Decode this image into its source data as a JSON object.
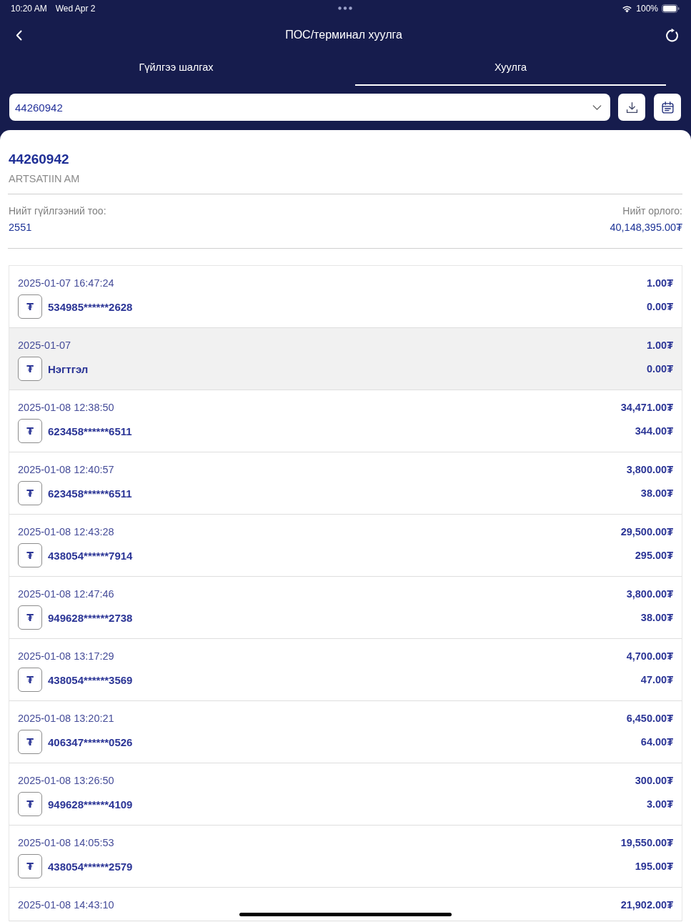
{
  "status_bar": {
    "time": "10:20 AM",
    "date": "Wed Apr 2",
    "battery": "100%"
  },
  "header": {
    "title": "ПОС/терминал хуулга"
  },
  "tabs": [
    {
      "label": "Гүйлгээ шалгах",
      "selected": false
    },
    {
      "label": "Хуулга",
      "selected": true
    }
  ],
  "terminal_select": {
    "value": "44260942"
  },
  "terminal": {
    "id": "44260942",
    "name": "ARTSATIIN AM"
  },
  "summary": [
    {
      "label": "Нийт гүйлгээний тоо:",
      "value": "2551"
    },
    {
      "label": "Нийт орлого:",
      "value": "40,148,395.00₮"
    }
  ],
  "transactions": [
    {
      "datetime": "2025-01-07 16:47:24",
      "icon": "₮",
      "card": "534985******2628",
      "amount": "1.00₮",
      "fee": "0.00₮",
      "selected": false
    },
    {
      "datetime": "2025-01-07",
      "icon": "₮",
      "card": "Нэгтгэл",
      "amount": "1.00₮",
      "fee": "0.00₮",
      "selected": true
    },
    {
      "datetime": "2025-01-08 12:38:50",
      "icon": "₮",
      "card": "623458******6511",
      "amount": "34,471.00₮",
      "fee": "344.00₮",
      "selected": false
    },
    {
      "datetime": "2025-01-08 12:40:57",
      "icon": "₮",
      "card": "623458******6511",
      "amount": "3,800.00₮",
      "fee": "38.00₮",
      "selected": false
    },
    {
      "datetime": "2025-01-08 12:43:28",
      "icon": "₮",
      "card": "438054******7914",
      "amount": "29,500.00₮",
      "fee": "295.00₮",
      "selected": false
    },
    {
      "datetime": "2025-01-08 12:47:46",
      "icon": "₮",
      "card": "949628******2738",
      "amount": "3,800.00₮",
      "fee": "38.00₮",
      "selected": false
    },
    {
      "datetime": "2025-01-08 13:17:29",
      "icon": "₮",
      "card": "438054******3569",
      "amount": "4,700.00₮",
      "fee": "47.00₮",
      "selected": false
    },
    {
      "datetime": "2025-01-08 13:20:21",
      "icon": "₮",
      "card": "406347******0526",
      "amount": "6,450.00₮",
      "fee": "64.00₮",
      "selected": false
    },
    {
      "datetime": "2025-01-08 13:26:50",
      "icon": "₮",
      "card": "949628******4109",
      "amount": "300.00₮",
      "fee": "3.00₮",
      "selected": false
    },
    {
      "datetime": "2025-01-08 14:05:53",
      "icon": "₮",
      "card": "438054******2579",
      "amount": "19,550.00₮",
      "fee": "195.00₮",
      "selected": false
    },
    {
      "datetime": "2025-01-08 14:43:10",
      "amount": "21,902.00₮",
      "selected": false
    }
  ]
}
